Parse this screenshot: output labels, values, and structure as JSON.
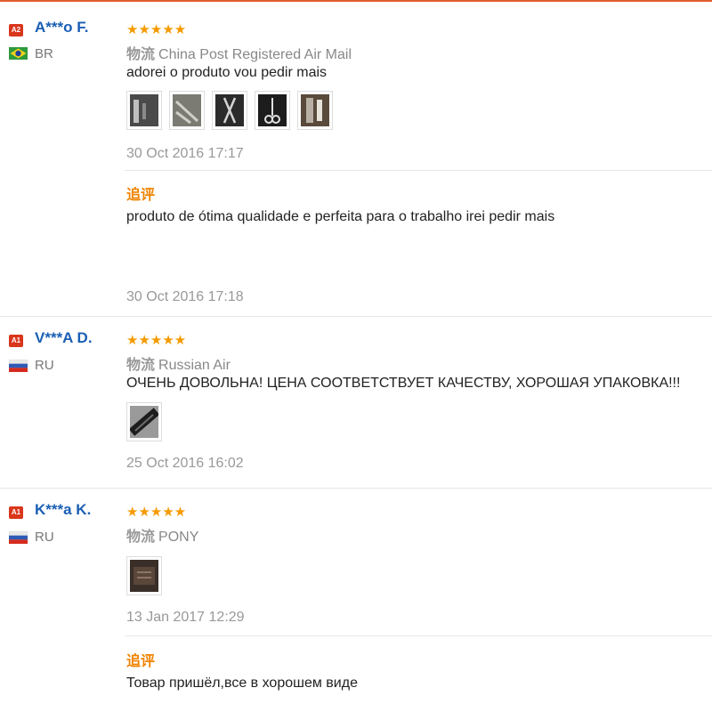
{
  "labels": {
    "shipping": "物流",
    "followup": "追评"
  },
  "reviews": [
    {
      "badge": "A2",
      "user": "A***o F.",
      "country": "BR",
      "stars": "★★★★★",
      "shipping": "China Post Registered Air Mail",
      "text": "adorei o produto vou pedir mais",
      "photos": 5,
      "date": "30 Oct 2016 17:17",
      "followup": {
        "text": "produto de ótima qualidade e perfeita para o trabalho irei pedir mais",
        "date": "30 Oct 2016 17:18"
      }
    },
    {
      "badge": "A1",
      "user": "V***A D.",
      "country": "RU",
      "stars": "★★★★★",
      "shipping": "Russian Air",
      "text": "ОЧЕНЬ ДОВОЛЬНА! ЦЕНА СООТВЕТСТВУЕТ КАЧЕСТВУ, ХОРОШАЯ УПАКОВКА!!!",
      "photos": 1,
      "date": "25 Oct 2016 16:02"
    },
    {
      "badge": "A1",
      "user": "K***a K.",
      "country": "RU",
      "stars": "★★★★★",
      "shipping": "PONY",
      "photos": 1,
      "date": "13 Jan 2017 12:29",
      "followup": {
        "text": "Товар пришёл,все в хорошем виде"
      }
    }
  ],
  "colors": {
    "accent": "#f08300",
    "username": "#1a5fb4",
    "badge": "#d9361c",
    "stars": "#f59a00"
  }
}
